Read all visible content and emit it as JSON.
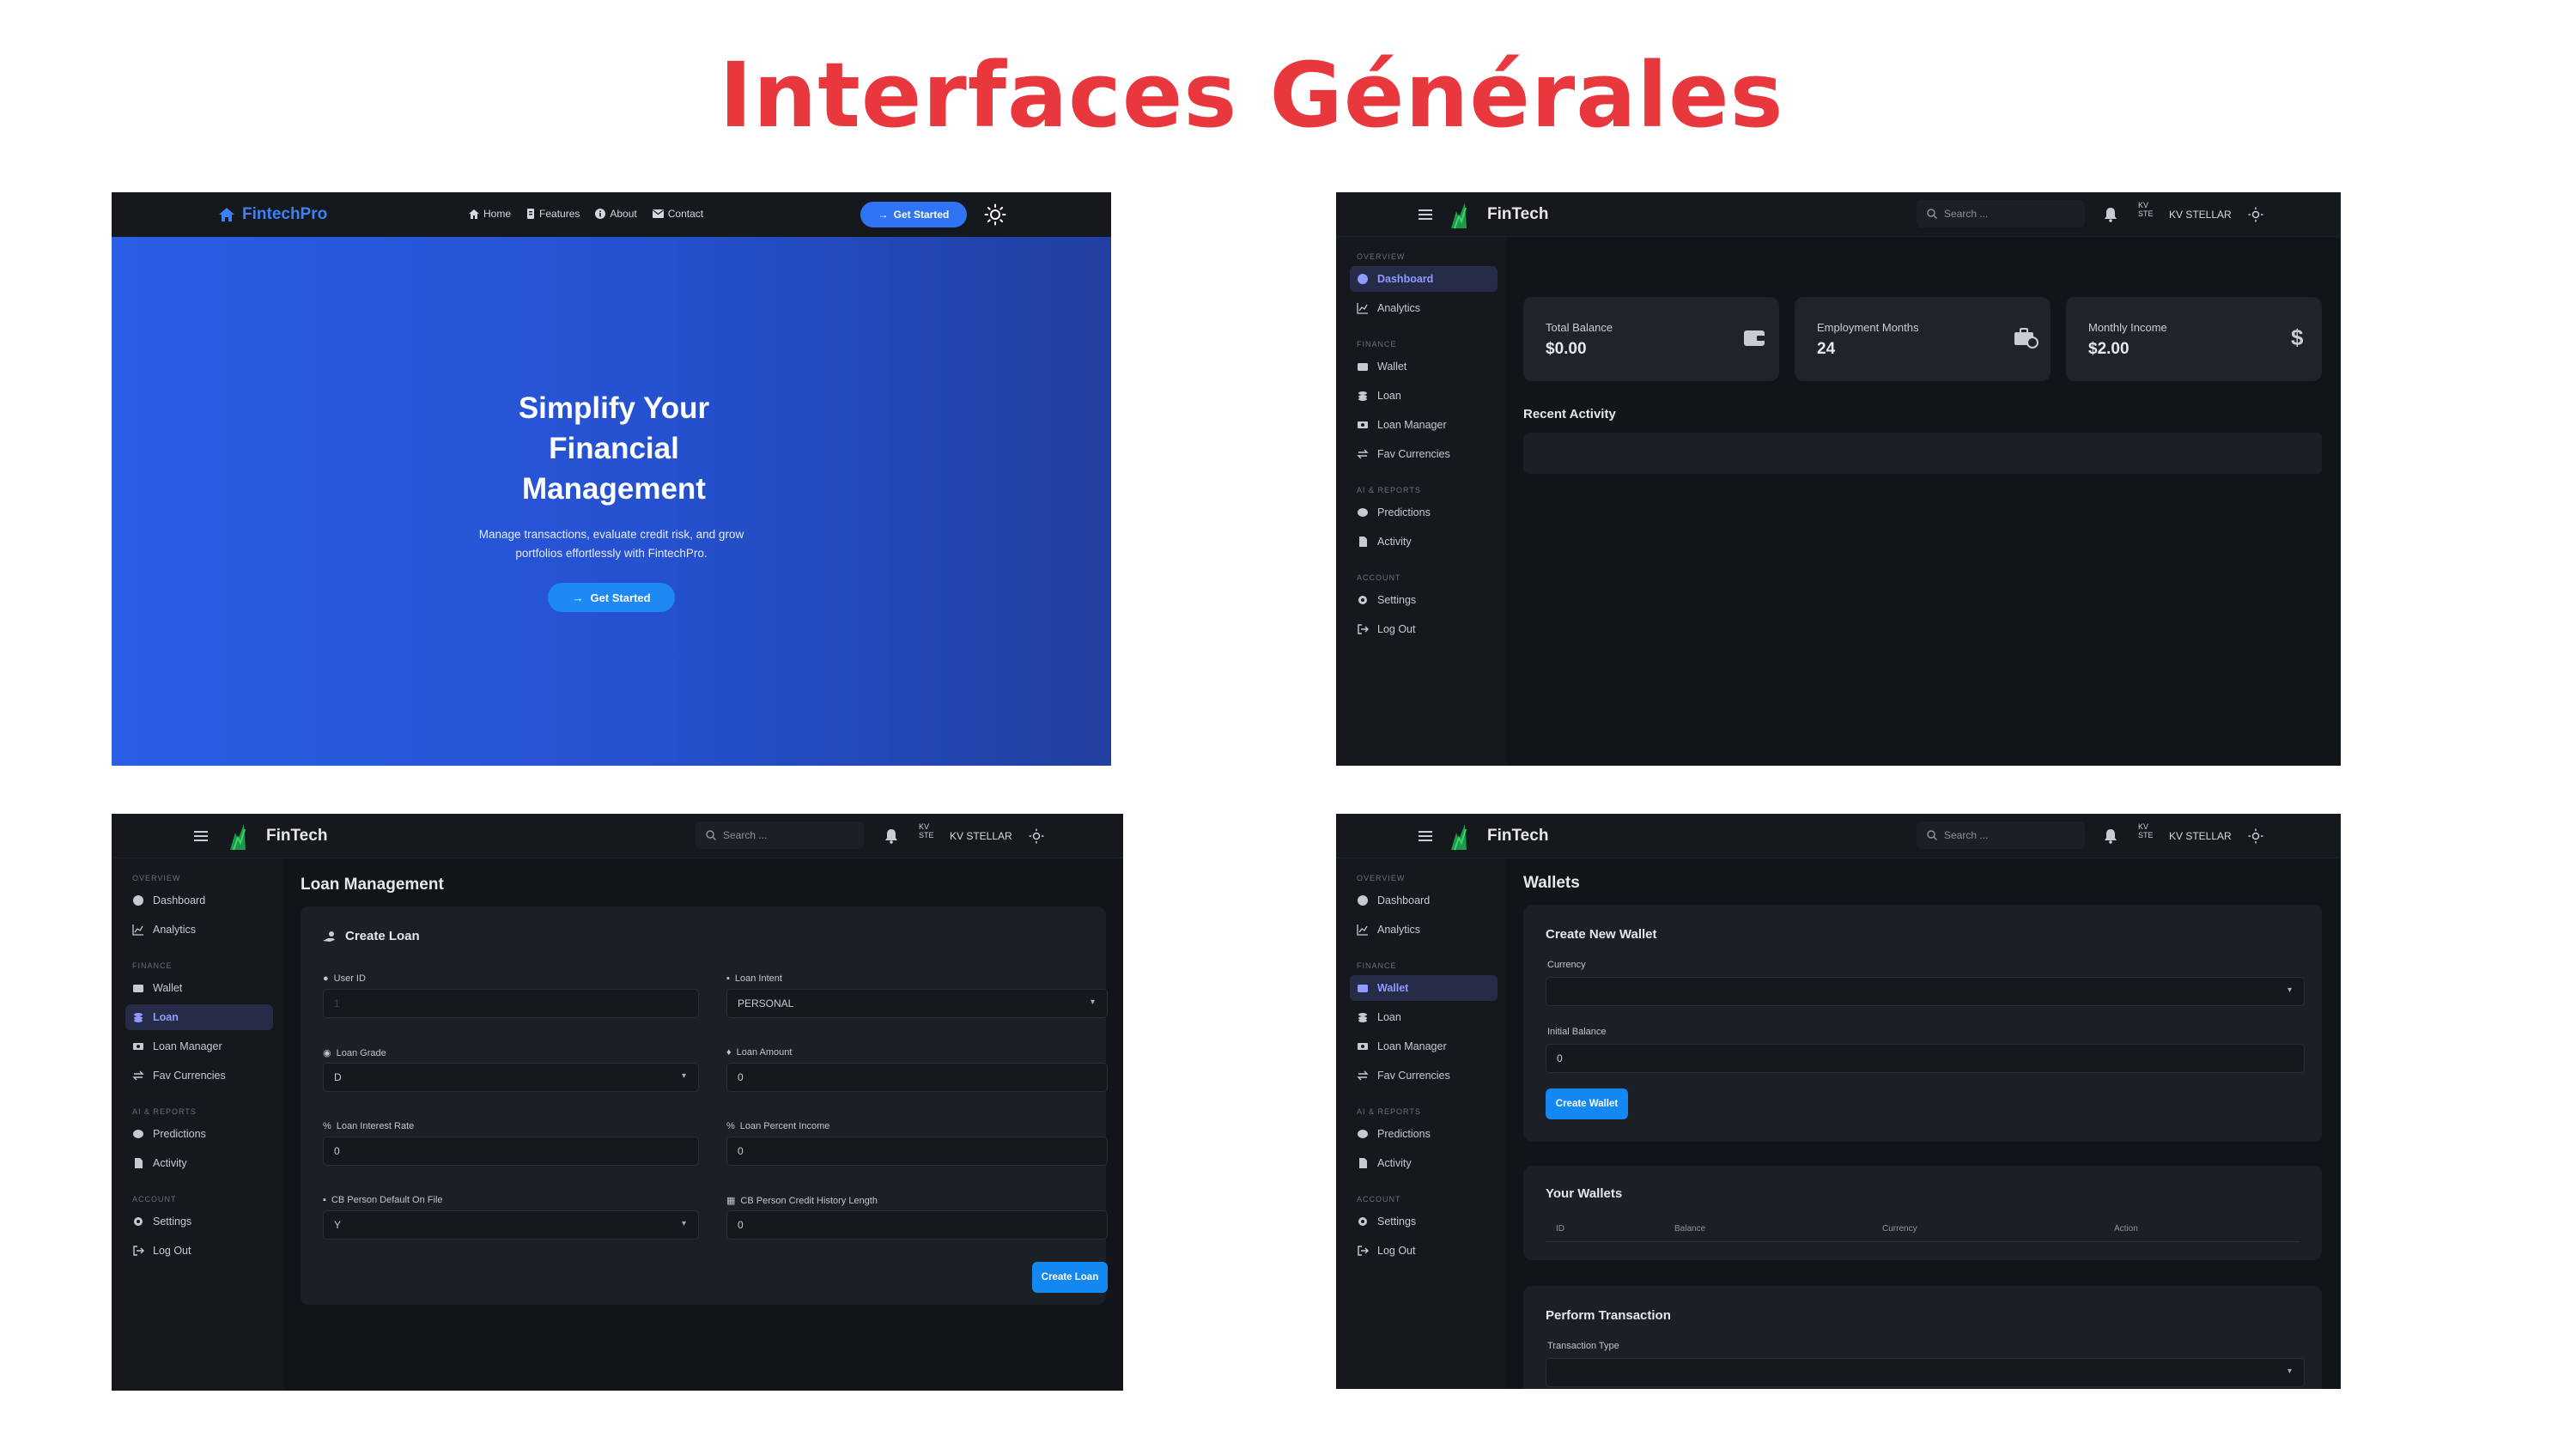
{
  "title": "Interfaces Générales",
  "colors": {
    "accent": "#1488f2",
    "title_red": "#e8383d",
    "dark_bg": "#111419",
    "sidebar_active": "#8f9bff"
  },
  "landing": {
    "brand": "FintechPro",
    "nav": [
      "Home",
      "Features",
      "About",
      "Contact"
    ],
    "nav_icons": [
      "home-icon",
      "features-icon",
      "info-icon",
      "mail-icon"
    ],
    "cta": "Get Started",
    "hero_title": [
      "Simplify Your",
      "Financial",
      "Management"
    ],
    "hero_sub": [
      "Manage transactions, evaluate credit risk, and grow",
      "portfolios effortlessly with FintechPro."
    ],
    "hero_cta": "Get Started"
  },
  "app": {
    "brand": "FinTech",
    "search_placeholder": "Search ...",
    "avatar_text": [
      "KV",
      "STE"
    ],
    "user_name": "KV STELLAR",
    "sections": [
      "OVERVIEW",
      "FINANCE",
      "AI & REPORTS",
      "ACCOUNT"
    ],
    "items": {
      "dashboard": "Dashboard",
      "analytics": "Analytics",
      "wallet": "Wallet",
      "loan": "Loan",
      "loan_manager": "Loan Manager",
      "fav_currencies": "Fav Currencies",
      "predictions": "Predictions",
      "activity": "Activity",
      "settings": "Settings",
      "logout": "Log Out"
    }
  },
  "dashboard": {
    "stats": [
      {
        "label": "Total Balance",
        "value": "$0.00",
        "icon": "wallet-icon"
      },
      {
        "label": "Employment Months",
        "value": "24",
        "icon": "briefcase-clock-icon"
      },
      {
        "label": "Monthly Income",
        "value": "$2.00",
        "icon": "dollar-icon"
      }
    ],
    "recent_activity": "Recent Activity"
  },
  "loan": {
    "page_title": "Loan Management",
    "card_title": "Create Loan",
    "fields": [
      {
        "label": "User ID",
        "value": "1",
        "type": "input"
      },
      {
        "label": "Loan Intent",
        "value": "PERSONAL",
        "type": "select"
      },
      {
        "label": "Loan Grade",
        "value": "D",
        "type": "select"
      },
      {
        "label": "Loan Amount",
        "value": "0",
        "type": "input"
      },
      {
        "label": "Loan Interest Rate",
        "value": "0",
        "type": "input"
      },
      {
        "label": "Loan Percent Income",
        "value": "0",
        "type": "input"
      },
      {
        "label": "CB Person Default On File",
        "value": "Y",
        "type": "select"
      },
      {
        "label": "CB Person Credit History Length",
        "value": "0",
        "type": "input"
      }
    ],
    "submit": "Create Loan"
  },
  "wallets": {
    "page_title": "Wallets",
    "create_title": "Create New Wallet",
    "currency_label": "Currency",
    "initial_balance_label": "Initial Balance",
    "initial_balance_value": "0",
    "create_button": "Create Wallet",
    "your_wallets_title": "Your Wallets",
    "columns": [
      "ID",
      "Balance",
      "Currency",
      "Action"
    ],
    "transaction_title": "Perform Transaction",
    "transaction_type_label": "Transaction Type"
  }
}
